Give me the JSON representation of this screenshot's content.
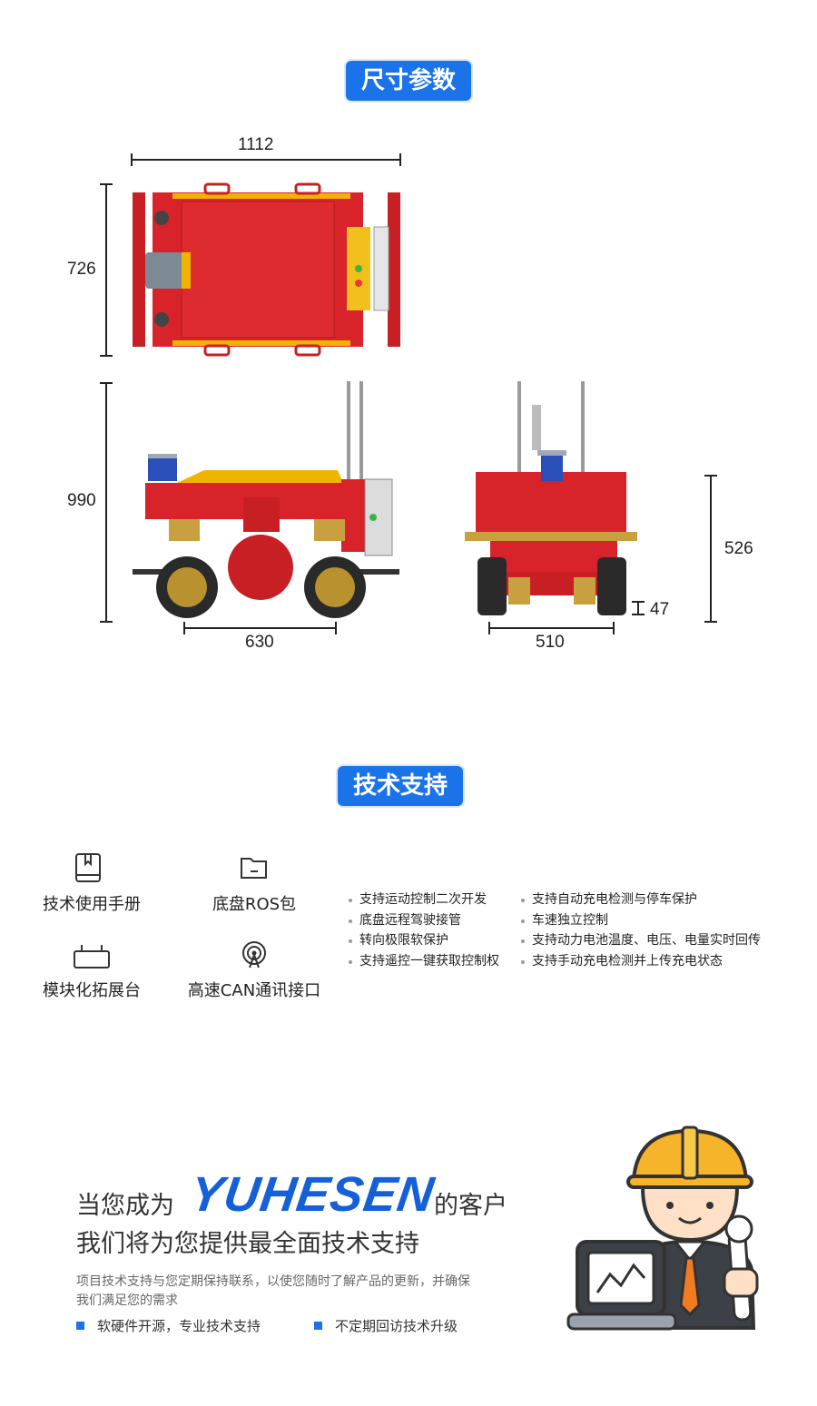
{
  "sections": {
    "dimensions_title": "尺寸参数",
    "tech_title": "技术支持"
  },
  "dimensions": {
    "top_width": "1112",
    "top_depth": "726",
    "side_height": "990",
    "side_wheelbase": "630",
    "front_height": "526",
    "front_track": "510",
    "ground_clearance": "47"
  },
  "tech_support": {
    "items": [
      {
        "label": "技术使用手册",
        "icon": "book-icon"
      },
      {
        "label": "底盘ROS包",
        "icon": "folder-icon"
      },
      {
        "label": "模块化拓展台",
        "icon": "expansion-platform-icon"
      },
      {
        "label": "高速CAN通讯接口",
        "icon": "signal-tower-icon"
      }
    ],
    "features_left": [
      "支持运动控制二次开发",
      "底盘远程驾驶接管",
      "转向极限软保护",
      "支持遥控一键获取控制权"
    ],
    "features_right": [
      "支持自动充电检测与停车保护",
      "车速独立控制",
      "支持动力电池温度、电压、电量实时回传",
      "支持手动充电检测并上传充电状态"
    ]
  },
  "promo": {
    "line1_prefix": "当您成为",
    "brand": "YUHESEN",
    "line1_suffix": "的客户",
    "line2": "我们将为您提供最全面技术支持",
    "description": "项目技术支持与您定期保持联系，以使您随时了解产品的更新，并确保我们满足您的需求",
    "bullet_1": "软硬件开源，专业技术支持",
    "bullet_2": "不定期回访技术升级"
  },
  "colors": {
    "accent": "#1a73e8",
    "robot_red": "#d8232a",
    "robot_yellow": "#f0b400"
  }
}
